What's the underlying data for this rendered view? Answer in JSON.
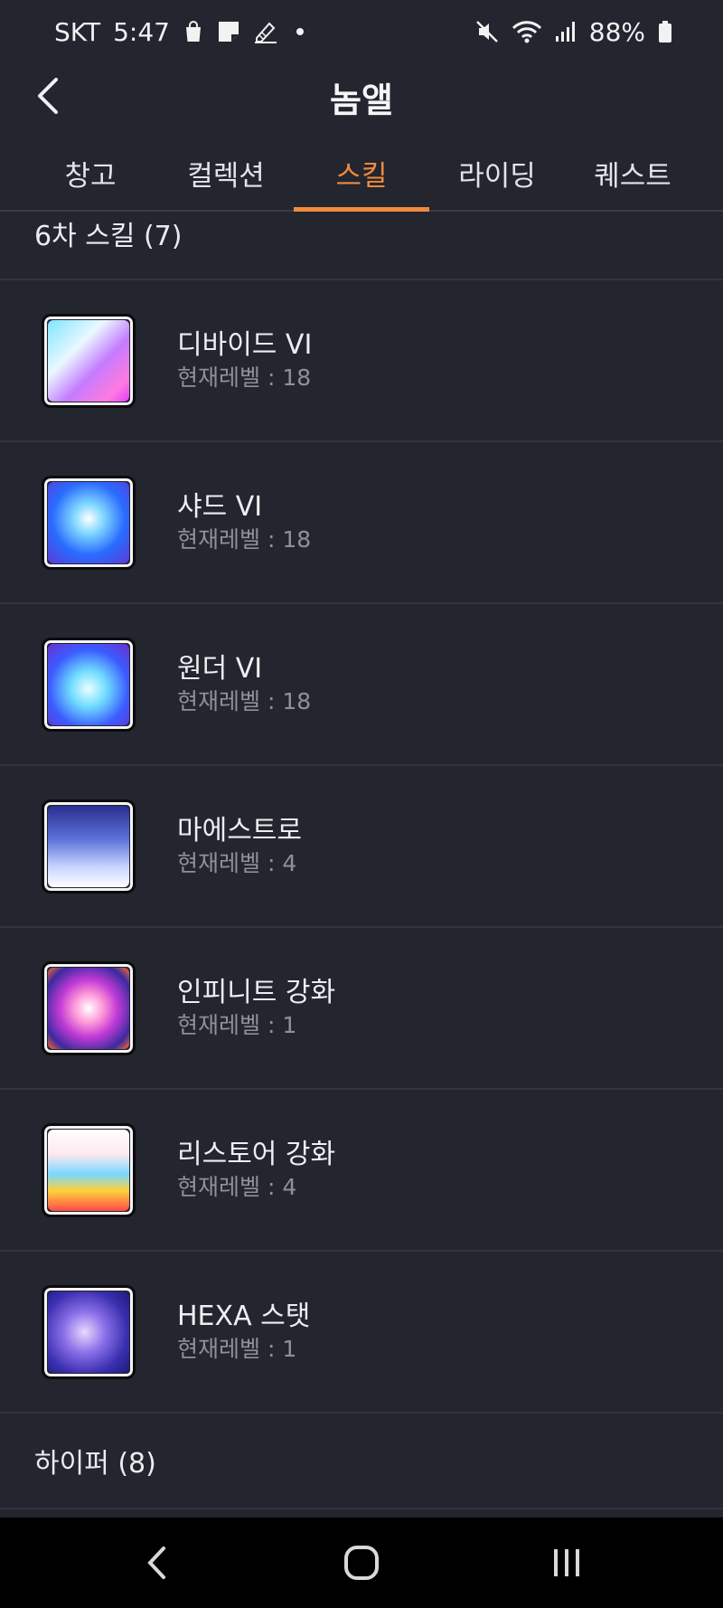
{
  "status_bar": {
    "carrier": "SKT",
    "time": "5:47",
    "battery": "88%",
    "icons": [
      "shopping-bag-icon",
      "note-icon",
      "edit-icon",
      "mute-icon",
      "wifi-icon",
      "signal-icon",
      "battery-icon"
    ]
  },
  "header": {
    "title": "놈앨",
    "back_icon": "back-arrow-icon"
  },
  "tabs": [
    {
      "label": "창고",
      "active": false
    },
    {
      "label": "컬렉션",
      "active": false
    },
    {
      "label": "스킬",
      "active": true
    },
    {
      "label": "라이딩",
      "active": false
    },
    {
      "label": "퀘스트",
      "active": false
    }
  ],
  "section_6th": {
    "title": "6차 스킬 (7)"
  },
  "skills": [
    {
      "name": "디바이드 VI",
      "level": "현재레벨 : 18",
      "icon": "divide-skill-icon"
    },
    {
      "name": "샤드 VI",
      "level": "현재레벨 : 18",
      "icon": "shard-skill-icon"
    },
    {
      "name": "원더 VI",
      "level": "현재레벨 : 18",
      "icon": "wonder-skill-icon"
    },
    {
      "name": "마에스트로",
      "level": "현재레벨 : 4",
      "icon": "maestro-skill-icon"
    },
    {
      "name": "인피니트 강화",
      "level": "현재레벨 : 1",
      "icon": "infinite-skill-icon"
    },
    {
      "name": "리스토어 강화",
      "level": "현재레벨 : 4",
      "icon": "restore-skill-icon"
    },
    {
      "name": "HEXA 스탯",
      "level": "현재레벨 : 1",
      "icon": "hexa-stat-icon"
    }
  ],
  "section_hyper": {
    "title": "하이퍼 (8)"
  },
  "nav_bar": {
    "buttons": [
      "back-nav-icon",
      "home-nav-icon",
      "recents-nav-icon"
    ]
  }
}
